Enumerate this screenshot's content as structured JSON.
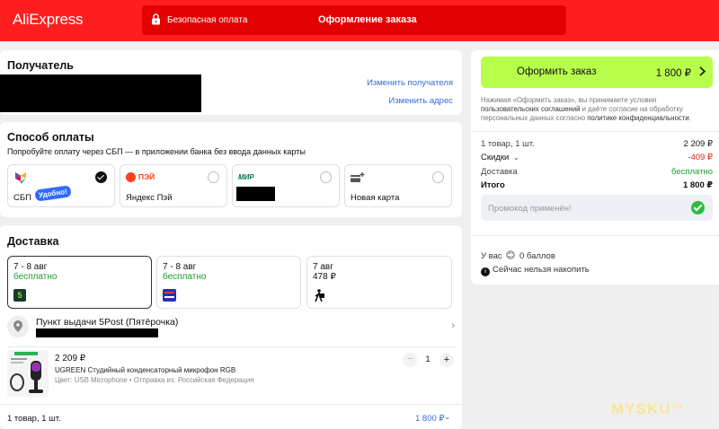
{
  "header": {
    "logo": "AliExpress",
    "secure_label": "Безопасная оплата",
    "title": "Оформление заказа"
  },
  "recipient": {
    "title": "Получатель",
    "change_recipient": "Изменить получателя",
    "change_address": "Изменить адрес"
  },
  "payment": {
    "title": "Способ оплаты",
    "hint": "Попробуйте оплату через СБП — в приложении банка без ввода данных карты",
    "methods": [
      {
        "label": "СБП",
        "badge": "Удобно!",
        "selected": true
      },
      {
        "label": "Яндекс Пэй",
        "logo": "ПЭЙ",
        "selected": false
      },
      {
        "label": "",
        "logo": "МИР",
        "selected": false
      },
      {
        "label": "Новая карта",
        "selected": false
      }
    ]
  },
  "delivery": {
    "title": "Доставка",
    "options": [
      {
        "date": "7 - 8 авг",
        "price": "бесплатно",
        "icon": "5post-icon",
        "selected": true
      },
      {
        "date": "7 - 8 авг",
        "price": "бесплатно",
        "icon": "pickup-point-icon",
        "selected": false
      },
      {
        "date": "7 авг",
        "price": "478 ₽",
        "icon": "courier-icon",
        "selected": false
      }
    ],
    "pickup_point": "Пункт выдачи 5Post (Пятёрочка)",
    "product": {
      "price": "2 209 ₽",
      "name": "UGREEN Студийный конденсаторный микрофон RGB",
      "variant": "Цвет: USB Microphone • Отправка из: Российская Федерация",
      "quantity": "1",
      "minus": "−",
      "plus": "+"
    },
    "footer_count": "1 товар, 1 шт.",
    "footer_price": "1 800 ₽"
  },
  "summary": {
    "order_label": "Оформить заказ",
    "order_price": "1 800 ₽",
    "terms_1": "Нажимая «Оформить заказ», вы принимаете условия ",
    "terms_link_1": "пользовательских соглашений",
    "terms_2": " и даёте согласие на обработку персональных данных согласно ",
    "terms_link_2": "политике конфиденциальности",
    "terms_3": ".",
    "rows": [
      {
        "label": "1 товар, 1 шт.",
        "value": "2 209 ₽"
      },
      {
        "label": "Скидки",
        "value": "-409 ₽"
      },
      {
        "label": "Доставка",
        "value": "бесплатно"
      },
      {
        "label": "Итого",
        "value": "1 800 ₽"
      }
    ],
    "promo": "Промокод применён!"
  },
  "points": {
    "balance_prefix": "У вас",
    "balance_value": "0 баллов",
    "notice": "Сейчас нельзя накопить"
  },
  "watermark": {
    "text": "MYSKU",
    "suffix": ".ru"
  },
  "colors": {
    "header": "#ff1e1e",
    "accent_green_button": "#b7ff4a",
    "free_green": "#1a9e2a",
    "discount_red": "#e02020",
    "link_blue": "#3b6ad6"
  }
}
